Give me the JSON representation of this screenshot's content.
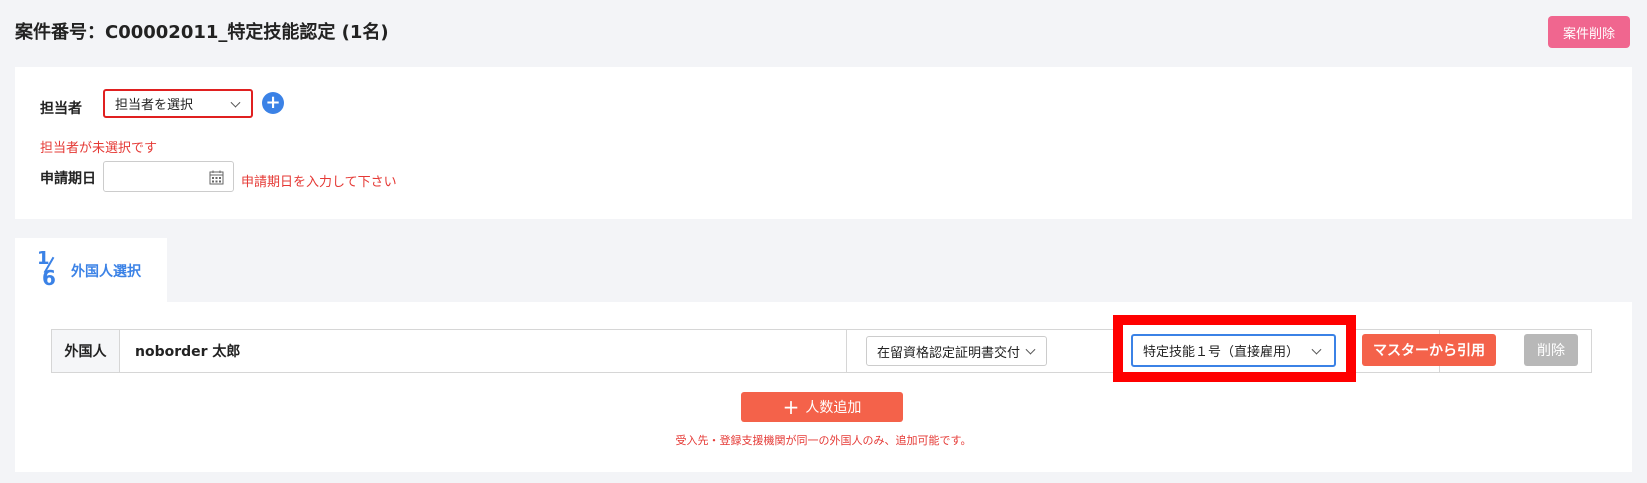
{
  "header": {
    "title": "案件番号：C00002011_特定技能認定 (1名)",
    "delete_case_label": "案件削除"
  },
  "form": {
    "assignee_label": "担当者",
    "assignee_select_value": "担当者を選択",
    "assignee_error": "担当者が未選択です",
    "application_date_label": "申請期日",
    "application_date_value": "",
    "application_date_error": "申請期日を入力して下さい"
  },
  "step_tab": {
    "step_current": "1",
    "step_total": "6",
    "label": "外国人選択"
  },
  "foreigner_row": {
    "label": "外国人",
    "name": "noborder 太郎",
    "application_type_value": "在留資格認定証明書交付",
    "visa_type_value": "特定技能１号（直接雇用）",
    "master_button_label": "マスターから引用",
    "delete_button_label": "削除"
  },
  "add_button": {
    "plus": "+",
    "label": "人数追加"
  },
  "note": "受入先・登録支援機関が同一の外国人のみ、追加可能です。",
  "colors": {
    "accent_blue": "#3b82e6",
    "primary_orange": "#f4624a",
    "error_red": "#e53935",
    "pink_delete": "#f0668f",
    "highlight_red": "#ff0000"
  }
}
